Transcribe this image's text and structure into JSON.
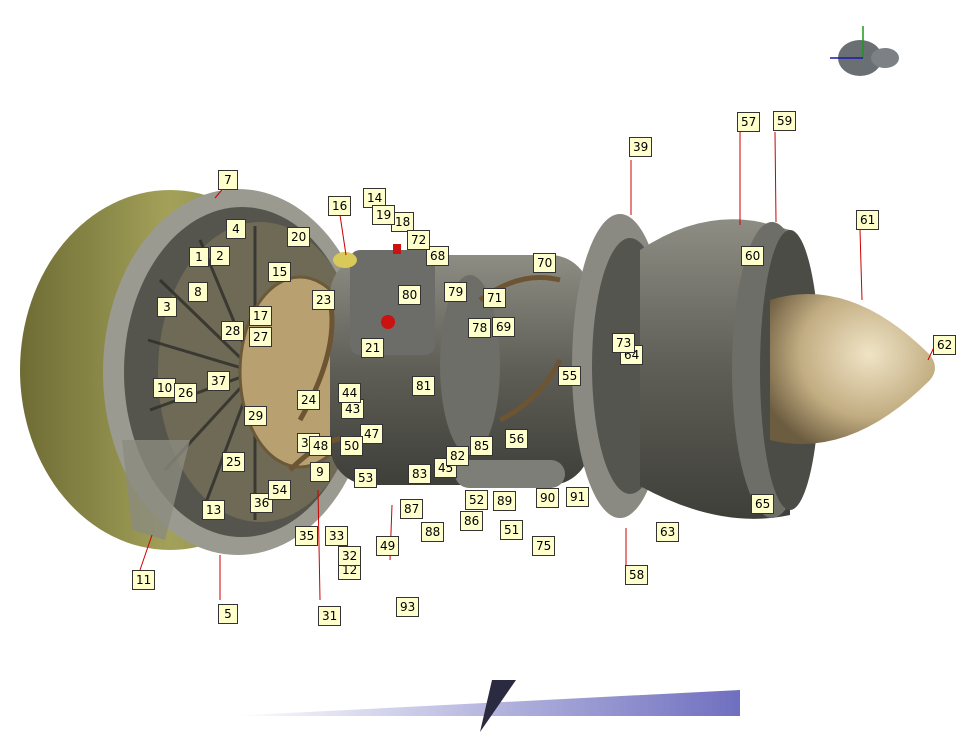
{
  "diagram": {
    "callouts": [
      "1",
      "2",
      "3",
      "4",
      "5",
      "7",
      "8",
      "9",
      "10",
      "11",
      "12",
      "13",
      "14",
      "15",
      "16",
      "17",
      "18",
      "19",
      "20",
      "21",
      "23",
      "24",
      "25",
      "26",
      "27",
      "28",
      "29",
      "30",
      "31",
      "32",
      "33",
      "35",
      "36",
      "37",
      "39",
      "43",
      "44",
      "45",
      "47",
      "48",
      "49",
      "50",
      "51",
      "52",
      "53",
      "54",
      "55",
      "56",
      "57",
      "58",
      "59",
      "60",
      "61",
      "62",
      "63",
      "64",
      "65",
      "68",
      "69",
      "70",
      "71",
      "72",
      "73",
      "75",
      "78",
      "79",
      "80",
      "81",
      "82",
      "83",
      "85",
      "86",
      "87",
      "88",
      "89",
      "90",
      "91",
      "93"
    ]
  },
  "colors": {
    "nacelle": "#8c8a48",
    "casing": "#7f7f78",
    "exhaust_cone": "#c8b48a",
    "callout_fill": "#ffffcc",
    "leader": "#cc0000",
    "gradient_bar": "#7b7bc7"
  }
}
